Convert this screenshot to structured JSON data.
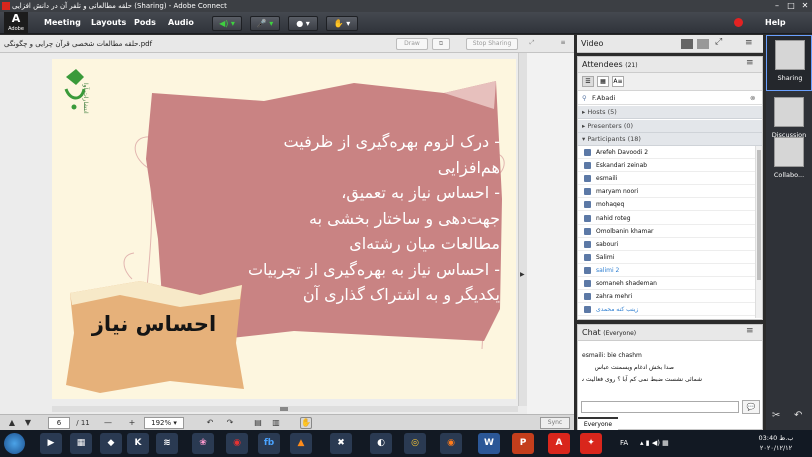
{
  "window": {
    "title": "حلقه مطالعاتی و تلفر آن در دانش افزایی (Sharing) - Adobe Connect"
  },
  "menubar": {
    "logo_label": "Adobe",
    "menus": [
      "Meeting",
      "Layouts",
      "Pods",
      "Audio"
    ],
    "help_label": "Help"
  },
  "share_pod": {
    "document_title": "حلقه مطالعات شخصی قرآن چرایی و چگونگی.pdf",
    "draw_label": "Draw",
    "stop_sharing_label": "Stop Sharing"
  },
  "slide": {
    "lines": [
      "- درک لزوم  بهره‌گیری از ظرفیت",
      "هم‌افزایی",
      "- احساس نیاز به تعمیق،",
      "جهت‌دهی و ساختار بخشی به",
      "مطالعات میان رشته‌ای",
      "- احساس نیاز به بهره‌گیری از تجربیات",
      "یکدیگر و به اشتراک گذاری آن"
    ],
    "label": "احساس نیاز",
    "logo_caption": "انتشارات آوا"
  },
  "pod_toolbar": {
    "page_current": "6",
    "page_total": "/ 11",
    "zoom": "192%",
    "sync_label": "Sync"
  },
  "video_pod": {
    "title": "Video"
  },
  "attendees_pod": {
    "title": "Attendees",
    "count": "(21)",
    "current_user": "F.Abadi",
    "groups": {
      "hosts": "Hosts (5)",
      "presenters": "Presenters (0)",
      "participants": "Participants (18)"
    },
    "participants": [
      {
        "name": "Arefeh Davoodi 2",
        "style": "normal"
      },
      {
        "name": "Eskandari zeinab",
        "style": "normal"
      },
      {
        "name": "esmaili",
        "style": "normal"
      },
      {
        "name": "maryam noori",
        "style": "normal"
      },
      {
        "name": "mohaqeq",
        "style": "normal"
      },
      {
        "name": "nahid roteg",
        "style": "normal"
      },
      {
        "name": "Omolbanin khamar",
        "style": "normal"
      },
      {
        "name": "sabouri",
        "style": "normal"
      },
      {
        "name": "Salimi",
        "style": "normal"
      },
      {
        "name": "salimi 2",
        "style": "blue"
      },
      {
        "name": "somaneh shademan",
        "style": "normal"
      },
      {
        "name": "zahra mehri",
        "style": "normal"
      },
      {
        "name": "زینب کنه محمدی",
        "style": "blue"
      }
    ]
  },
  "chat_pod": {
    "title": "Chat",
    "audience": "(Everyone)",
    "messages": [
      "esmaili: bie chashm",
      "صدا بخش ادغام ویسمنت عباس",
      "شمائی نشست ضبط نمی کم آبا ؟ روی فعالیت سوی"
    ],
    "tab_label": "Everyone"
  },
  "layouts_panel": {
    "items": [
      "Sharing",
      "Discussion",
      "Collabo..."
    ]
  },
  "taskbar": {
    "lang": "FA",
    "time": "03:40 ب.ظ",
    "date": "۲۰۲۰/۱۲/۱۲"
  },
  "colors": {
    "paper": "#c98383",
    "slide_bg": "#fdf6df",
    "accent_green": "#3fd13f",
    "record_red": "#e32222"
  }
}
